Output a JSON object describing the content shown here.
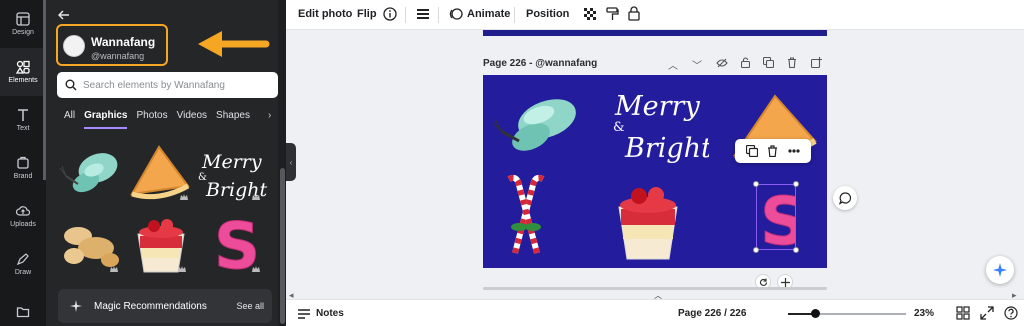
{
  "rail": {
    "items": [
      {
        "label": "Design",
        "icon": "design-icon"
      },
      {
        "label": "Elements",
        "icon": "elements-icon",
        "active": true
      },
      {
        "label": "Text",
        "icon": "text-icon"
      },
      {
        "label": "Brand",
        "icon": "brand-icon"
      },
      {
        "label": "Uploads",
        "icon": "uploads-icon"
      },
      {
        "label": "Draw",
        "icon": "draw-icon"
      },
      {
        "label": "",
        "icon": "folder-icon"
      }
    ]
  },
  "panel": {
    "profile_name": "Wannafang",
    "profile_handle": "@wannafang",
    "search_placeholder": "Search elements by Wannafang",
    "tabs": [
      "All",
      "Graphics",
      "Photos",
      "Videos",
      "Shapes"
    ],
    "active_tab": "Graphics",
    "grid_text": {
      "merry": "Merry",
      "bright": "Bright",
      "amp": "&"
    },
    "magic_label": "Magic Recommendations",
    "see_all": "See all",
    "highlight_color": "#f5a623"
  },
  "toolbar": {
    "edit_photo": "Edit photo",
    "flip": "Flip",
    "animate": "Animate",
    "position": "Position"
  },
  "canvas": {
    "page_title": "Page 226 - @wannafang",
    "page_bg": "#231c9c",
    "text_merry": "Merry",
    "text_bright": "Bright",
    "text_amp": "&",
    "letter": "S"
  },
  "bottom": {
    "notes": "Notes",
    "page_info": "Page 226 / 226",
    "zoom": "23%",
    "zoom_level": 0.23
  }
}
